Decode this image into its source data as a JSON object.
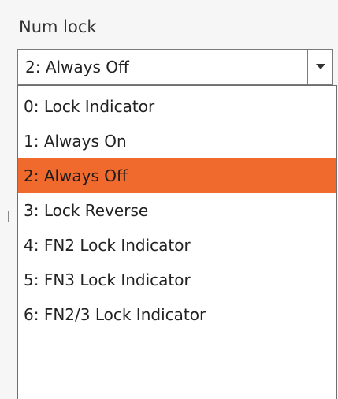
{
  "field": {
    "label": "Num lock",
    "selected_value": "2: Always Off"
  },
  "dropdown": {
    "options": [
      {
        "label": "0: Lock Indicator",
        "selected": false
      },
      {
        "label": "1: Always On",
        "selected": false
      },
      {
        "label": "2: Always Off",
        "selected": true
      },
      {
        "label": "3: Lock Reverse",
        "selected": false
      },
      {
        "label": "4: FN2 Lock Indicator",
        "selected": false
      },
      {
        "label": "5: FN3 Lock Indicator",
        "selected": false
      },
      {
        "label": "6: FN2/3 Lock Indicator",
        "selected": false
      }
    ]
  },
  "colors": {
    "highlight": "#f06a2e",
    "border": "#7a7a7a",
    "text": "#222222"
  },
  "icons": {
    "dropdown_arrow": "chevron-down-icon"
  }
}
